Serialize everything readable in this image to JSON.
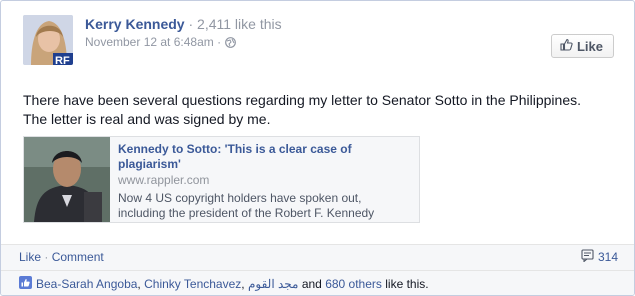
{
  "post": {
    "author": "Kerry Kennedy",
    "like_count": "· 2,411 like this",
    "timestamp": "November 12 at 6:48am ·",
    "text_line1": "There have been several questions regarding my letter to Senator Sotto in the Philippines.",
    "text_line2": "The letter is real and was signed by me.",
    "like_button": "Like"
  },
  "link": {
    "title_line1": "Kennedy to Sotto: 'This is a clear case of",
    "title_line2": "plagiarism'",
    "domain": "www.rappler.com",
    "desc_line1": "Now 4 US copyright holders have spoken out,",
    "desc_line2": "including the president of the Robert F. Kennedy"
  },
  "actions": {
    "like": "Like",
    "sep": "·",
    "comment": "Comment",
    "comment_count": "314"
  },
  "likes_summary": {
    "person1": "Bea-Sarah Angoba",
    "comma1": ",",
    "person2": "Chinky Tenchavez",
    "comma2": ",",
    "person3": "مجد القوم",
    "and": "and",
    "others": "680 others",
    "suffix": "like this."
  },
  "icons": {
    "globe": "globe-icon",
    "thumbs_up": "thumbs-up-icon",
    "comment": "comment-icon"
  },
  "colors": {
    "brand": "#3b5998",
    "muted": "#9197a3",
    "text": "#141823"
  }
}
